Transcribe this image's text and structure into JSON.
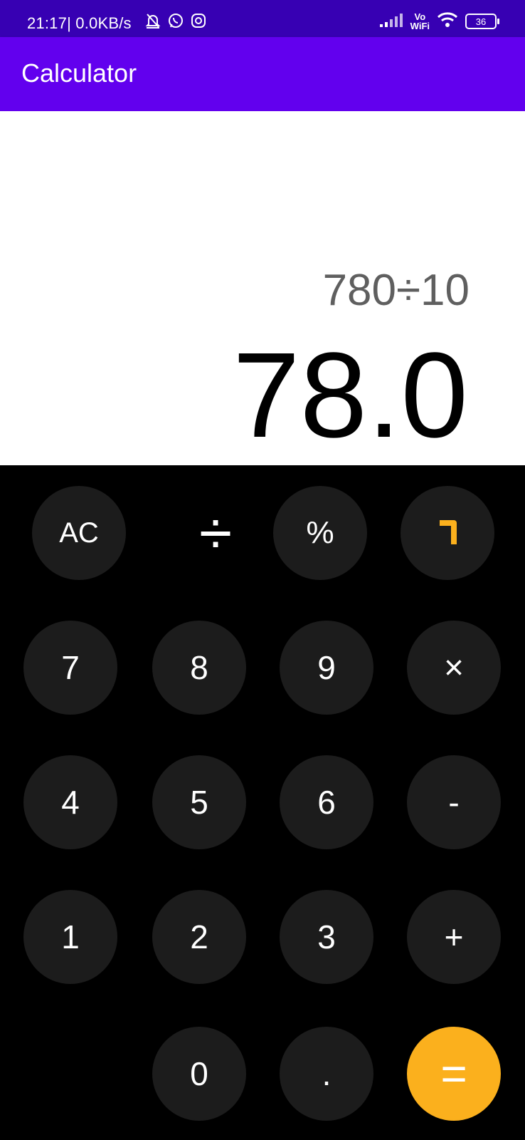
{
  "status_bar": {
    "time": "21:17",
    "speed": "| 0.0KB/s",
    "vowifi_top": "Vo",
    "vowifi_bottom": "WiFi",
    "battery": "36",
    "icons": [
      "muted-bell-icon",
      "whatsapp-icon",
      "messenger-icon",
      "signal-icon",
      "wifi-icon",
      "battery-icon"
    ]
  },
  "app_bar": {
    "title": "Calculator"
  },
  "display": {
    "expression": "780÷10",
    "result": "78.0"
  },
  "keys": {
    "ac": "AC",
    "divide": "÷",
    "percent": "%",
    "backspace": "backspace-icon",
    "seven": "7",
    "eight": "8",
    "nine": "9",
    "multiply": "×",
    "four": "4",
    "five": "5",
    "six": "6",
    "minus": "-",
    "one": "1",
    "two": "2",
    "three": "3",
    "plus": "+",
    "zero": "0",
    "decimal": ".",
    "equals": "="
  },
  "colors": {
    "status_bar": "#3700b3",
    "app_bar": "#6200ee",
    "key_background": "#1c1c1c",
    "accent": "#fbb01d"
  }
}
